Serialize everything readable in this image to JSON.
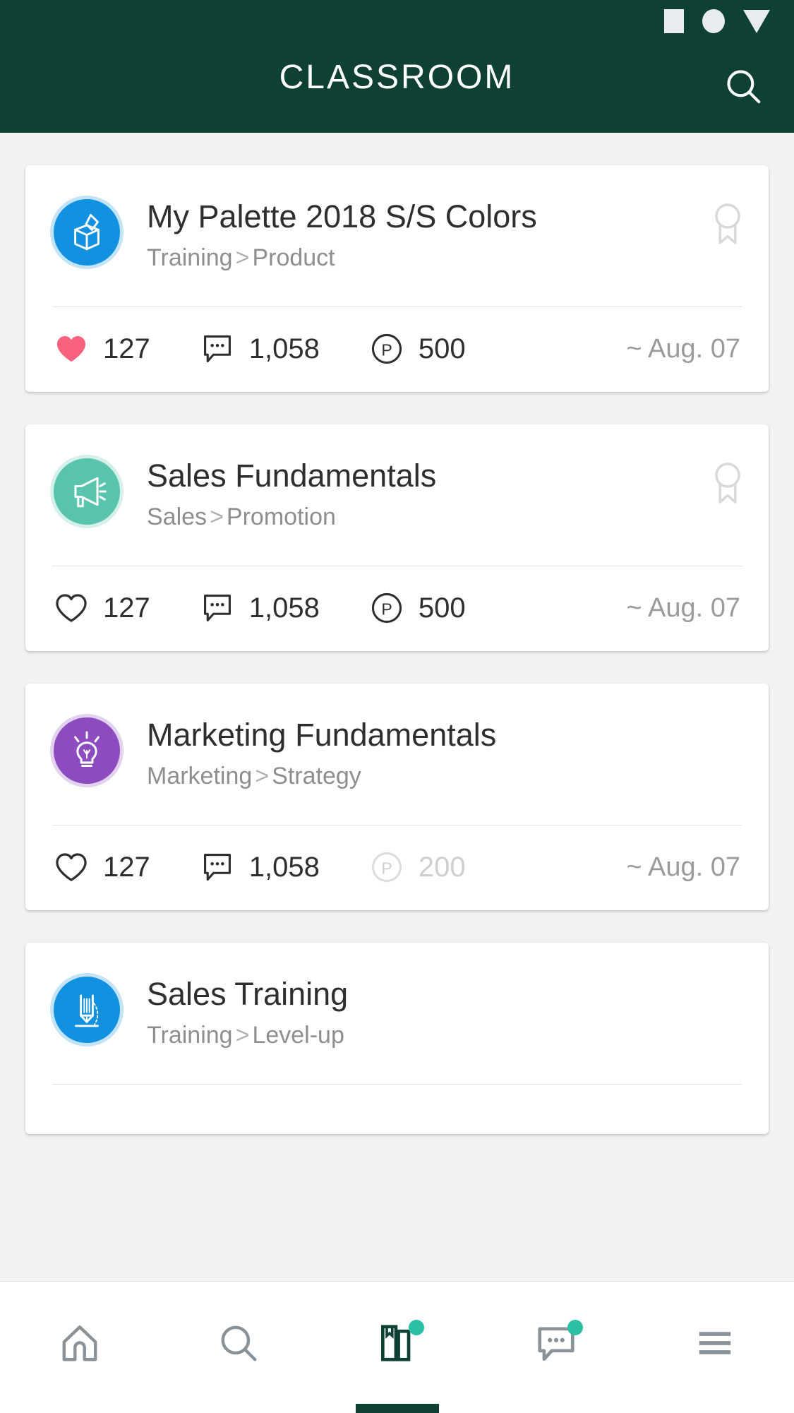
{
  "statusbar": {
    "icons": [
      "square-placeholder-icon",
      "circle-placeholder-icon",
      "triangle-placeholder-icon"
    ]
  },
  "header": {
    "title": "CLASSROOM",
    "search_icon": "search-icon",
    "background_color": "#0f4034"
  },
  "colors": {
    "header_green": "#0f4034",
    "accent_teal": "#2bbfa4",
    "heart_pink": "#f9617e",
    "icon_blue": "#1191e0",
    "icon_teal": "#59c4ae",
    "icon_purple": "#8c4cc0",
    "muted_gray": "#9b9b9b",
    "disabled_gray": "#cfcfcf"
  },
  "courses": [
    {
      "title": "My Palette 2018 S/S Colors",
      "category": "Training",
      "subcategory": "Product",
      "separator": ">",
      "icon": "open-box-pen-icon",
      "icon_color": "#1191e0",
      "badge_icon": "award-ribbon-icon",
      "liked": true,
      "likes_icon": "heart-filled-icon",
      "likes": "127",
      "comments_icon": "comment-bubble-icon",
      "comments": "1,058",
      "points_icon": "point-p-icon",
      "points": "500",
      "points_disabled": false,
      "due_date": "~ Aug. 07"
    },
    {
      "title": "Sales Fundamentals",
      "category": "Sales",
      "subcategory": "Promotion",
      "separator": ">",
      "icon": "megaphone-icon",
      "icon_color": "#59c4ae",
      "badge_icon": "award-ribbon-icon",
      "liked": false,
      "likes_icon": "heart-outline-icon",
      "likes": "127",
      "comments_icon": "comment-bubble-icon",
      "comments": "1,058",
      "points_icon": "point-p-icon",
      "points": "500",
      "points_disabled": false,
      "due_date": "~ Aug. 07"
    },
    {
      "title": "Marketing Fundamentals",
      "category": "Marketing",
      "subcategory": "Strategy",
      "separator": ">",
      "icon": "lightbulb-icon",
      "icon_color": "#8c4cc0",
      "badge_icon": null,
      "liked": false,
      "likes_icon": "heart-outline-icon",
      "likes": "127",
      "comments_icon": "comment-bubble-icon",
      "comments": "1,058",
      "points_icon": "point-p-icon",
      "points": "200",
      "points_disabled": true,
      "due_date": "~ Aug. 07"
    },
    {
      "title": "Sales Training",
      "category": "Training",
      "subcategory": "Level-up",
      "separator": ">",
      "icon": "pencil-curve-icon",
      "icon_color": "#1191e0",
      "badge_icon": null,
      "liked": false,
      "likes_icon": "heart-outline-icon",
      "likes": "",
      "comments_icon": "comment-bubble-icon",
      "comments": "",
      "points_icon": "point-p-icon",
      "points": "",
      "points_disabled": false,
      "due_date": ""
    }
  ],
  "bottom_nav": {
    "items": [
      {
        "name": "home",
        "icon": "home-icon",
        "active": false,
        "badge": false
      },
      {
        "name": "search",
        "icon": "search-icon",
        "active": false,
        "badge": false
      },
      {
        "name": "classroom",
        "icon": "book-icon",
        "active": true,
        "badge": true
      },
      {
        "name": "messages",
        "icon": "chat-bubble-icon",
        "active": false,
        "badge": true
      },
      {
        "name": "more",
        "icon": "hamburger-icon",
        "active": false,
        "badge": false
      }
    ]
  }
}
